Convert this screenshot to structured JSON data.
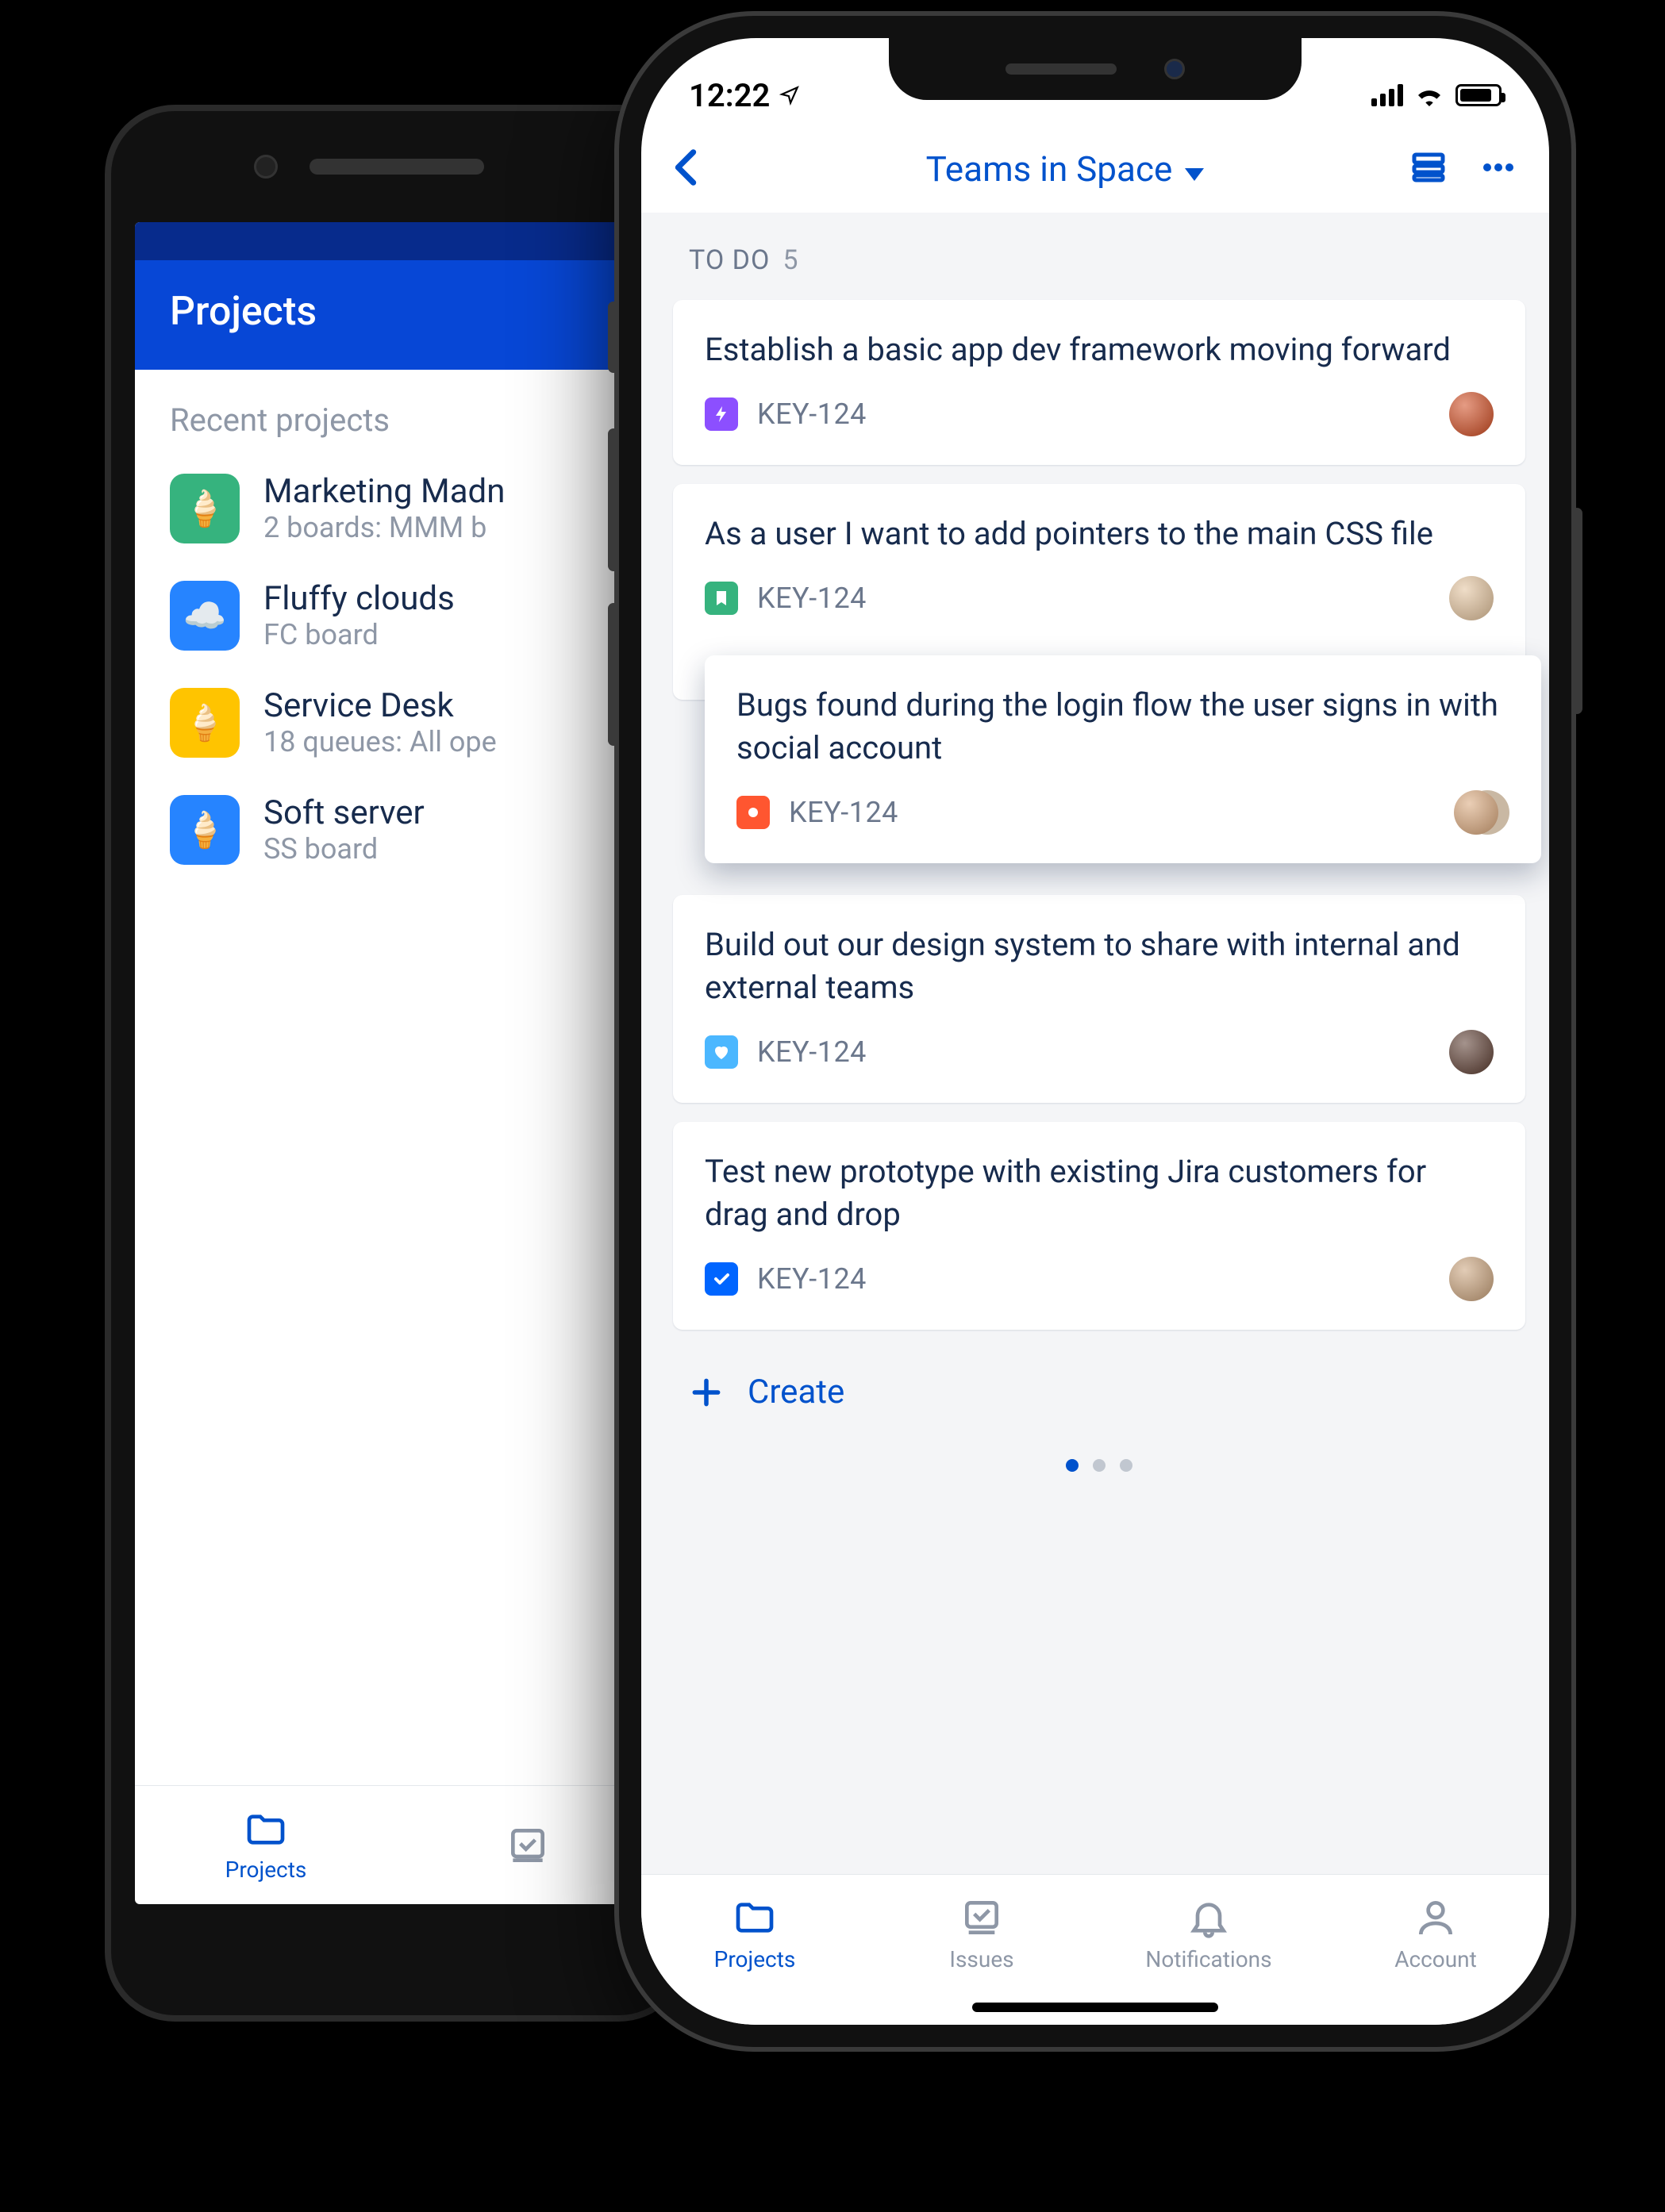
{
  "android": {
    "header": {
      "title": "Projects"
    },
    "section_title": "Recent projects",
    "projects": [
      {
        "name": "Marketing Madn",
        "subtitle": "2 boards: MMM b",
        "icon_bg": "#36b37e"
      },
      {
        "name": "Fluffy clouds",
        "subtitle": "FC board",
        "icon_bg": "#2684ff"
      },
      {
        "name": "Service Desk",
        "subtitle": "18 queues: All ope",
        "icon_bg": "#ffc400"
      },
      {
        "name": "Soft server",
        "subtitle": "SS board",
        "icon_bg": "#2684ff"
      }
    ],
    "nav": {
      "projects": "Projects"
    }
  },
  "iphone": {
    "status": {
      "time": "12:22"
    },
    "nav": {
      "title": "Teams in Space"
    },
    "column": {
      "label": "TO DO",
      "count": "5"
    },
    "cards": [
      {
        "title": "Establish a basic app dev framework moving forward",
        "key": "KEY-124",
        "type": "epic",
        "type_bg": "#8c4fff",
        "avatar_bg": "#d04a1f"
      },
      {
        "title": "As a user I want to add pointers to the main CSS file",
        "key": "KEY-124",
        "type": "story",
        "type_bg": "#36b37e",
        "avatar_bg": "#e3c29b"
      },
      {
        "title": "Bugs found during the login flow the user signs in with social account",
        "key": "KEY-124",
        "type": "bug",
        "type_bg": "#ff5630",
        "avatar_bg": "#d9a679",
        "dragged": true,
        "avatar_pair": true
      },
      {
        "title": "Build out our design system to share with internal and external teams",
        "key": "KEY-124",
        "type": "improvement",
        "type_bg": "#4bb7ff",
        "avatar_bg": "#5a3a2e"
      },
      {
        "title": "Test new prototype with existing Jira customers for drag and drop",
        "key": "KEY-124",
        "type": "task",
        "type_bg": "#0065ff",
        "avatar_bg": "#caa27a"
      }
    ],
    "create_label": "Create",
    "page_active": 0,
    "tabbar": {
      "projects": "Projects",
      "issues": "Issues",
      "notifications": "Notifications",
      "account": "Account"
    }
  }
}
